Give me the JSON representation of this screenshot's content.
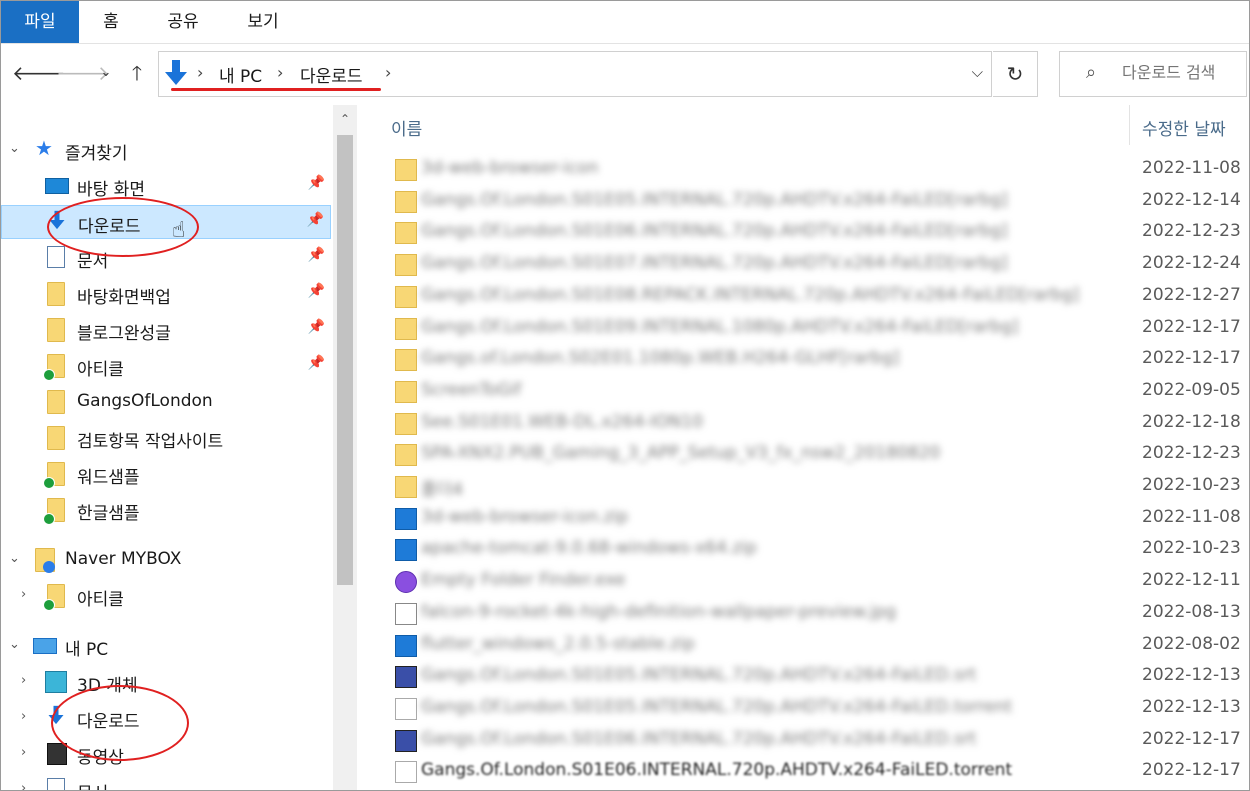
{
  "ribbon": {
    "tabs": [
      "파일",
      "홈",
      "공유",
      "보기"
    ]
  },
  "address": {
    "crumbs": [
      "내 PC",
      "다운로드"
    ]
  },
  "search": {
    "placeholder": "다운로드 검색"
  },
  "sidebar": {
    "quick_access": "즐겨찾기",
    "pinned": [
      {
        "label": "바탕 화면",
        "icon": "desktop-icon"
      },
      {
        "label": "다운로드",
        "icon": "download-icon"
      },
      {
        "label": "문서",
        "icon": "document-icon"
      },
      {
        "label": "바탕화면백업",
        "icon": "folder-icon"
      },
      {
        "label": "블로그완성글",
        "icon": "folder-icon"
      },
      {
        "label": "아티클",
        "icon": "folder-synced-icon"
      }
    ],
    "folders": [
      {
        "label": "GangsOfLondon",
        "icon": "folder-icon"
      },
      {
        "label": "검토항목 작업사이트",
        "icon": "folder-icon"
      },
      {
        "label": "워드샘플",
        "icon": "folder-synced-icon"
      },
      {
        "label": "한글샘플",
        "icon": "folder-synced-icon"
      }
    ],
    "mybox": "Naver MYBOX",
    "mybox_child": "아티클",
    "this_pc": "내 PC",
    "pc_items": [
      {
        "label": "3D 개체",
        "icon": "3d-objects-icon"
      },
      {
        "label": "다운로드",
        "icon": "download-icon"
      },
      {
        "label": "동영상",
        "icon": "video-icon"
      },
      {
        "label": "문서",
        "icon": "document-icon"
      }
    ]
  },
  "columns": {
    "name": "이름",
    "date": "수정한 날짜"
  },
  "files": [
    {
      "name": "3d-web-browser-icon",
      "date": "2022-11-08",
      "type": "folder"
    },
    {
      "name": "Gangs.Of.London.S01E05.INTERNAL.720p.AHDTV.x264-FaiLED[rarbg]",
      "date": "2022-12-14",
      "type": "folder"
    },
    {
      "name": "Gangs.Of.London.S01E06.INTERNAL.720p.AHDTV.x264-FaiLED[rarbg]",
      "date": "2022-12-23",
      "type": "folder"
    },
    {
      "name": "Gangs.Of.London.S01E07.INTERNAL.720p.AHDTV.x264-FaiLED[rarbg]",
      "date": "2022-12-24",
      "type": "folder"
    },
    {
      "name": "Gangs.Of.London.S01E08.REPACK.INTERNAL.720p.AHDTV.x264-FaiLED[rarbg]",
      "date": "2022-12-27",
      "type": "folder"
    },
    {
      "name": "Gangs.Of.London.S01E09.INTERNAL.1080p.AHDTV.x264-FaiLED[rarbg]",
      "date": "2022-12-17",
      "type": "folder"
    },
    {
      "name": "Gangs.of.London.S02E01.1080p.WEB.H264-GLHF[rarbg]",
      "date": "2022-12-17",
      "type": "folder"
    },
    {
      "name": "ScreenToGif",
      "date": "2022-09-05",
      "type": "folder"
    },
    {
      "name": "See.S01E01.WEB-DL.x264-ION10",
      "date": "2022-12-18",
      "type": "folder"
    },
    {
      "name": "SPA-XNX2.PUB_Gaming_3_APP_Setup_V3_fx_nsw2_20180820",
      "date": "2022-12-23",
      "type": "folder"
    },
    {
      "name": "폴더4",
      "date": "2022-10-23",
      "type": "folder"
    },
    {
      "name": "3d-web-browser-icon.zip",
      "date": "2022-11-08",
      "type": "zip"
    },
    {
      "name": "apache-tomcat-9.0.68-windows-x64.zip",
      "date": "2022-10-23",
      "type": "zip"
    },
    {
      "name": "Empty Folder Finder.exe",
      "date": "2022-12-11",
      "type": "exe"
    },
    {
      "name": "falcon-9-rocket-4k-high-definition-wallpaper-preview.jpg",
      "date": "2022-08-13",
      "type": "jpg"
    },
    {
      "name": "flutter_windows_2.0.5-stable.zip",
      "date": "2022-08-02",
      "type": "zip"
    },
    {
      "name": "Gangs.Of.London.S01E05.INTERNAL.720p.AHDTV.x264-FaiLED.srt",
      "date": "2022-12-13",
      "type": "srt"
    },
    {
      "name": "Gangs.Of.London.S01E05.INTERNAL.720p.AHDTV.x264-FaiLED.torrent",
      "date": "2022-12-13",
      "type": "torrent"
    },
    {
      "name": "Gangs.Of.London.S01E06.INTERNAL.720p.AHDTV.x264-FaiLED.srt",
      "date": "2022-12-17",
      "type": "srt"
    },
    {
      "name": "Gangs.Of.London.S01E06.INTERNAL.720p.AHDTV.x264-FaiLED.torrent",
      "date": "2022-12-17",
      "type": "torrent"
    }
  ],
  "colors": {
    "accent": "#1a6fc4",
    "selection": "#cce8ff",
    "annotation": "#e02020",
    "folder": "#f8d775"
  }
}
